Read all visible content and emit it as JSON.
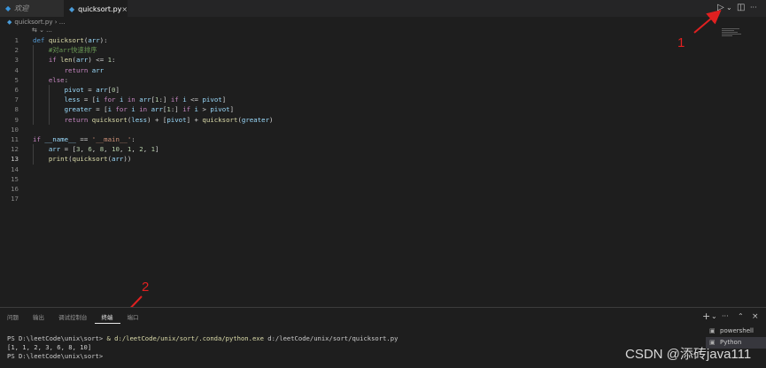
{
  "tabs": [
    {
      "label": "欢迎",
      "icon": "vscode-icon"
    },
    {
      "label": "quicksort.py",
      "icon": "python-file-icon",
      "close": "×"
    }
  ],
  "tab_controls": {
    "run": "▷",
    "run_menu": "⌄",
    "split": "◫",
    "more": "···"
  },
  "breadcrumb": {
    "file": "quicksort.py",
    "sep": "›",
    "tail": "...",
    "symbol": "⇆ ⌄ ..."
  },
  "code_lines": [
    {
      "n": "1",
      "html": "<span class='kw'>def</span> <span class='fn'>quicksort</span>(<span class='va'>arr</span>):"
    },
    {
      "n": "2",
      "html": "    <span class='cm'>#对arr快速排序</span>"
    },
    {
      "n": "3",
      "html": "    <span class='kwc'>if</span> <span class='fn'>len</span>(<span class='va'>arr</span>) &lt;= <span class='nu'>1</span>:"
    },
    {
      "n": "4",
      "html": "        <span class='kwc'>return</span> <span class='va'>arr</span>"
    },
    {
      "n": "5",
      "html": "    <span class='kwc'>else</span>:"
    },
    {
      "n": "6",
      "html": "        <span class='va'>pivot</span> = <span class='va'>arr</span>[<span class='nu'>0</span>]"
    },
    {
      "n": "7",
      "html": "        <span class='va'>less</span> = [<span class='va'>i</span> <span class='kwc'>for</span> <span class='va'>i</span> <span class='kwc'>in</span> <span class='va'>arr</span>[<span class='nu'>1</span>:] <span class='kwc'>if</span> <span class='va'>i</span> &lt;= <span class='va'>pivot</span>]"
    },
    {
      "n": "8",
      "html": "        <span class='va'>greater</span> = [<span class='va'>i</span> <span class='kwc'>for</span> <span class='va'>i</span> <span class='kwc'>in</span> <span class='va'>arr</span>[<span class='nu'>1</span>:] <span class='kwc'>if</span> <span class='va'>i</span> &gt; <span class='va'>pivot</span>]"
    },
    {
      "n": "9",
      "html": "        <span class='kwc'>return</span> <span class='fn'>quicksort</span>(<span class='va'>less</span>) + [<span class='va'>pivot</span>] + <span class='fn'>quicksort</span>(<span class='va'>greater</span>)"
    },
    {
      "n": "10",
      "html": ""
    },
    {
      "n": "11",
      "html": "<span class='kwc'>if</span> <span class='va'>__name__</span> == <span class='st'>'__main__'</span>:"
    },
    {
      "n": "12",
      "html": "    <span class='va'>arr</span> = [<span class='nu'>3</span>, <span class='nu'>6</span>, <span class='nu'>8</span>, <span class='nu'>10</span>, <span class='nu'>1</span>, <span class='nu'>2</span>, <span class='nu'>1</span>]"
    },
    {
      "n": "13",
      "html": "    <span class='fn'>print</span>(<span class='fn'>quicksort</span>(<span class='va'>arr</span>))"
    },
    {
      "n": "14",
      "html": ""
    },
    {
      "n": "15",
      "html": ""
    },
    {
      "n": "16",
      "html": ""
    },
    {
      "n": "17",
      "html": ""
    }
  ],
  "current_line": "13",
  "annotations": {
    "one": "1",
    "two": "2"
  },
  "panel": {
    "tabs": [
      "问题",
      "输出",
      "调试控制台",
      "终端",
      "端口"
    ],
    "active_tab": "终端",
    "controls": {
      "add": "+",
      "add_menu": "⌄",
      "more": "···",
      "maximize": "⌃",
      "close": "×"
    }
  },
  "terminal": {
    "line1_prompt": "PS D:\\leetCode\\unix\\sort> ",
    "line1_cmd": "& d:/leetCode/unix/sort/.conda/python.exe",
    "line1_arg": " d:/leetCode/unix/sort/quicksort.py",
    "line2": "[1, 1, 2, 3, 6, 8, 10]",
    "line3": "PS D:\\leetCode\\unix\\sort> "
  },
  "shells": [
    {
      "label": "powershell",
      "icon": "terminal-icon"
    },
    {
      "label": "Python",
      "icon": "terminal-icon"
    }
  ],
  "watermark": "CSDN @添砖java111",
  "colors": {
    "accent_red": "#e02020",
    "editor_bg": "#1e1e1e"
  }
}
